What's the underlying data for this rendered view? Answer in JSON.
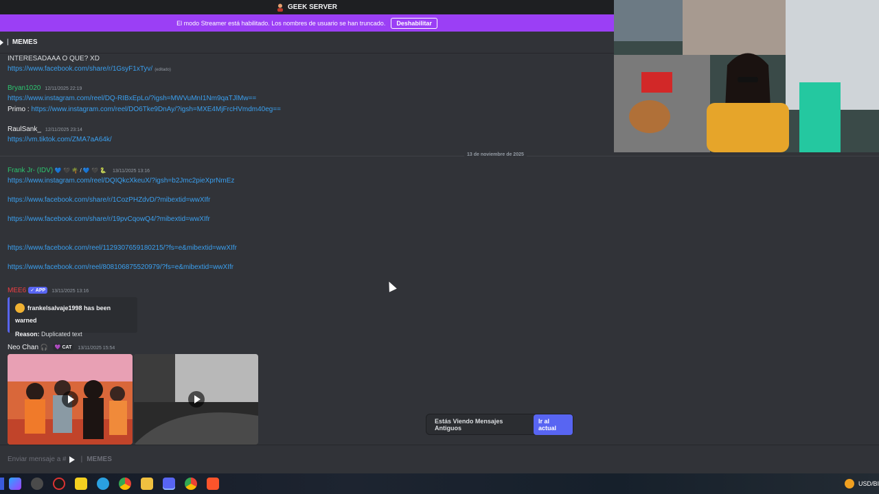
{
  "window": {
    "server_name": "GEEK SERVER"
  },
  "streamer_banner": {
    "message": "El modo Streamer está habilitado. Los nombres de usuario se han truncado.",
    "disable_label": "Deshabilitar"
  },
  "channel": {
    "separator": "|",
    "name": "MEMES"
  },
  "messages": [
    {
      "text": "INTERESADAAA O QUE? XD",
      "link": "https://www.facebook.com/share/r/1GsyF1xTyv/",
      "edited": "(editado)"
    },
    {
      "author": "Bryan1020",
      "author_color": "#2dc770",
      "timestamp": "12/11/2025 22:19",
      "link": "https://www.instagram.com/reel/DQ-RIBxEpLo/?igsh=MWVuMnI1Nm9qaTJlMw==",
      "line2_prefix": "Primo :",
      "line2_link": "https://www.instagram.com/reel/DO6Tke9DnAy/?igsh=MXE4MjFrcHVmdm40eg=="
    },
    {
      "author": "RaulSank_",
      "author_color": "#f2f3f5",
      "timestamp": "12/11/2025 23:14",
      "link": "https://vm.tiktok.com/ZMA7aA64k/"
    },
    {
      "author": "Frank Jr- (IDV)",
      "author_color": "#2dc770",
      "author_emojis": "💙 🖤 🌴 / 💙 🖤 🐍",
      "timestamp": "13/11/2025 13:16",
      "links": [
        "https://www.instagram.com/reel/DQIQkcXkeuX/?igsh=b2Jmc2pieXprNmEz",
        "https://www.facebook.com/share/r/1CozPHZdvD/?mibextid=wwXIfr",
        "https://www.facebook.com/share/r/19pvCqowQ4/?mibextid=wwXIfr",
        "https://www.facebook.com/reel/1129307659180215/?fs=e&mibextid=wwXIfr",
        "https://www.facebook.com/reel/808106875520979/?fs=e&mibextid=wwXIfr"
      ]
    },
    {
      "author": "MEE6",
      "author_color": "#f23f43",
      "badge": "✓ APP",
      "timestamp": "13/11/2025 13:16",
      "embed_title": "frankelsalvaje1998 has been warned",
      "embed_reason_label": "Reason:",
      "embed_reason": "Duplicated text"
    },
    {
      "author": "Neo Chan",
      "author_color": "#f2f3f5",
      "headphones": "🎧",
      "cat_badge": "💜 CAT",
      "timestamp": "13/11/2025 15:54"
    }
  ],
  "date_divider": "13 de noviembre de 2025",
  "old_messages": {
    "text": "Estás Viendo Mensajes Antiguos",
    "jump_label": "Ir al actual"
  },
  "composer": {
    "placeholder": "Enviar mensaje a #",
    "separator": "|",
    "channel": "MEMES"
  },
  "tray": {
    "currency": "USD/BI"
  },
  "colors": {
    "bg": "#313338",
    "banner": "#9b3ff5",
    "link": "#3aa0f0",
    "blurple": "#5865f2"
  }
}
